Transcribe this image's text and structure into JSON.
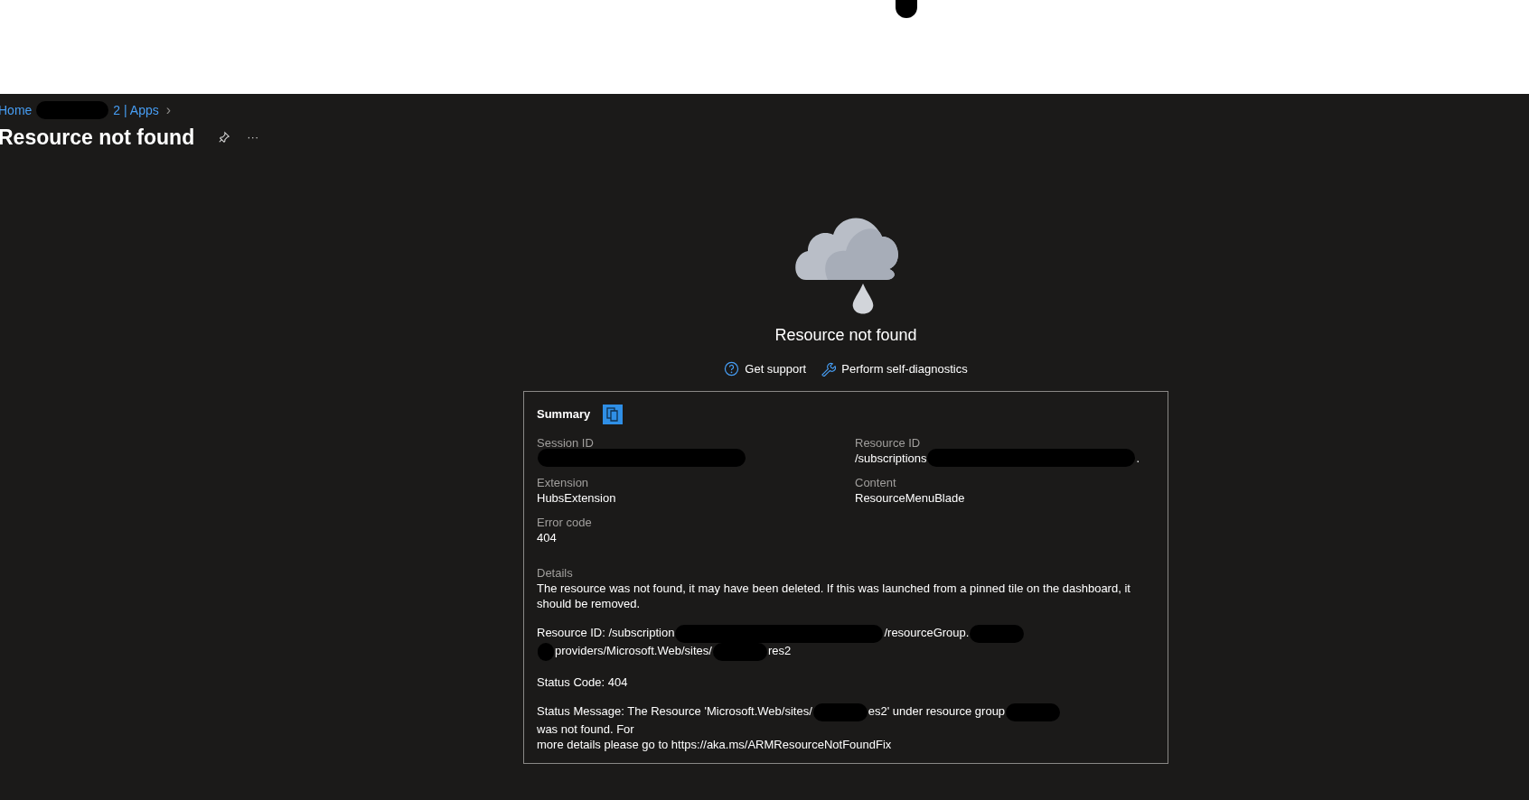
{
  "breadcrumb": [
    {
      "kind": "link",
      "text": "Home"
    },
    {
      "kind": "redacted_l"
    },
    {
      "kind": "link",
      "text": "2 | Apps"
    },
    {
      "kind": "chevron",
      "text": "›"
    }
  ],
  "page_title": "Resource not found",
  "title_actions": [
    {
      "kind": "pin"
    },
    {
      "kind": "more",
      "text": "···"
    }
  ],
  "message": "Resource not found",
  "links": [
    {
      "kind": "support",
      "text": "Get support"
    },
    {
      "kind": "diagnostics",
      "text": "Perform self-diagnostics"
    }
  ],
  "summary": {
    "title": "Summary",
    "fields": [
      {
        "label": "Session ID",
        "parts": [
          {
            "kind": "redacted_xl"
          }
        ]
      },
      {
        "label": "Resource ID",
        "parts": [
          {
            "kind": "text",
            "text": "/subscriptions"
          },
          {
            "kind": "redacted_xl"
          },
          {
            "kind": "text",
            "text": "."
          }
        ]
      },
      {
        "label": "Extension",
        "parts": [
          {
            "kind": "text",
            "text": "HubsExtension"
          }
        ]
      },
      {
        "label": "Content",
        "parts": [
          {
            "kind": "text",
            "text": "ResourceMenuBlade"
          }
        ]
      },
      {
        "label": "Error code",
        "parts": [
          {
            "kind": "text",
            "text": "404"
          }
        ]
      }
    ],
    "details_label": "Details",
    "details": [
      [
        {
          "kind": "para",
          "text": "The resource was not found, it may have been deleted. If this was launched from a pinned tile on the dashboard, it should be removed."
        }
      ],
      [
        {
          "kind": "text",
          "text": "Resource ID: /subscription"
        },
        {
          "kind": "redacted_xl"
        },
        {
          "kind": "text",
          "text": "/resourceGroup."
        },
        {
          "kind": "redacted_m"
        },
        {
          "kind": "break"
        },
        {
          "kind": "redacted_s"
        },
        {
          "kind": "text",
          "text": "providers/Microsoft.Web/sites/"
        },
        {
          "kind": "redacted_m"
        },
        {
          "kind": "text",
          "text": "res2"
        }
      ],
      [
        {
          "kind": "text",
          "text": "Status Code: 404"
        }
      ],
      [
        {
          "kind": "text",
          "text": "Status Message: The Resource 'Microsoft.Web/sites/"
        },
        {
          "kind": "redacted_m"
        },
        {
          "kind": "text",
          "text": "es2' under resource group"
        },
        {
          "kind": "redacted_m"
        },
        {
          "kind": "text",
          "text": "was not found. For"
        },
        {
          "kind": "break"
        },
        {
          "kind": "text",
          "text": "more details please go to https://aka.ms/ARMResourceNotFoundFix"
        }
      ]
    ]
  }
}
